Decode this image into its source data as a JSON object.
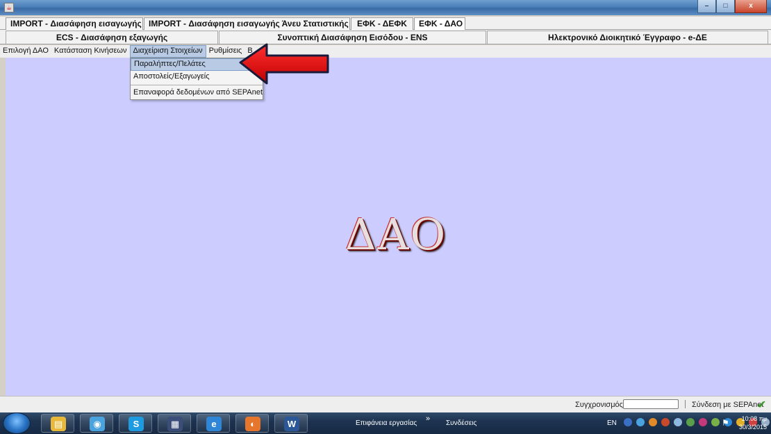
{
  "window": {
    "buttons": {
      "minimize": "–",
      "maximize": "□",
      "close": "x"
    }
  },
  "tabs_row1": [
    {
      "label": "IMPORT - Διασάφηση εισαγωγής",
      "active": false
    },
    {
      "label": "IMPORT - Διασάφηση εισαγωγής Άνευ Στατιστικής",
      "active": false
    },
    {
      "label": "ΕΦΚ - ΔΕΦΚ",
      "active": false
    },
    {
      "label": "ΕΦΚ - ΔΑΟ",
      "active": true
    }
  ],
  "tabs_row2": [
    {
      "label": "ECS - Διασάφηση εξαγωγής"
    },
    {
      "label": "Συνοπτική Διασάφηση Εισόδου - ENS"
    },
    {
      "label": "Ηλεκτρονικό Διοικητικό Έγγραφο - e-ΔΕ"
    }
  ],
  "menu": [
    {
      "label": "Επιλογή ΔΑΟ"
    },
    {
      "label": "Κατάσταση Κινήσεων"
    },
    {
      "label": "Διαχείριση Στοιχείων",
      "open": true
    },
    {
      "label": "Ρυθμίσεις"
    },
    {
      "label": "Β"
    }
  ],
  "dropdown": {
    "items": [
      {
        "label": "Παραλήπτες/Πελάτες",
        "highlighted": true
      },
      {
        "label": "Αποστολείς/Εξαγωγείς",
        "highlighted": false
      },
      {
        "label": "Επαναφορά δεδομένων από SEPAnet",
        "highlighted": false
      }
    ]
  },
  "content": {
    "logo_text": "ΔΑΟ",
    "background": "#ccccff"
  },
  "status": {
    "sync_label": "Συγχρονισμός",
    "sepanet_label": "Σύνδεση με SEPAnet",
    "sepanet_icon": "check-icon"
  },
  "taskbar": {
    "pinned": [
      {
        "name": "explorer",
        "color": "#e7b83a",
        "glyph": "▤"
      },
      {
        "name": "chrome",
        "color": "#4aa3df",
        "glyph": "◉"
      },
      {
        "name": "skype",
        "color": "#1e9be0",
        "glyph": "S"
      },
      {
        "name": "sepa",
        "color": "#3b4e7a",
        "glyph": "▦"
      },
      {
        "name": "internet-explorer",
        "color": "#2f86d6",
        "glyph": "e"
      },
      {
        "name": "firefox",
        "color": "#e6762c",
        "glyph": "◐"
      },
      {
        "name": "word",
        "color": "#2b5797",
        "glyph": "W"
      }
    ],
    "desktop_label": "Επιφάνεια εργασίας",
    "chevron": "»",
    "links_label": "Συνδέσεις",
    "lang": "EN",
    "time": "10:08 πμ",
    "date": "30/3/2015",
    "accent_red": "#e01010"
  }
}
